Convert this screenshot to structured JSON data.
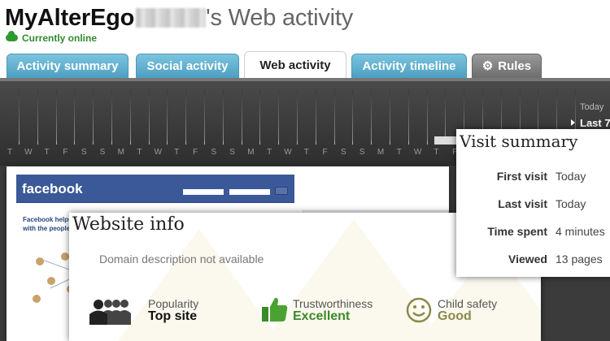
{
  "header": {
    "username": "MyAlterEgo",
    "title_suffix": "'s Web activity",
    "status": "Currently online"
  },
  "tabs": [
    {
      "label": "Activity summary",
      "icon": null
    },
    {
      "label": "Social activity",
      "icon": null
    },
    {
      "label": "Web activity",
      "icon": null,
      "active": true
    },
    {
      "label": "Activity timeline",
      "icon": null
    },
    {
      "label": "Rules",
      "icon": "gear-icon"
    }
  ],
  "timeline": {
    "days": [
      "T",
      "W",
      "T",
      "F",
      "S",
      "S",
      "M",
      "T",
      "W",
      "T",
      "F",
      "S",
      "S",
      "M",
      "T",
      "W",
      "T",
      "F",
      "S",
      "S",
      "M",
      "T",
      "W",
      "T",
      "F",
      "S",
      "S",
      "M",
      "T",
      "W",
      "T"
    ],
    "highlighted_days": [
      29,
      30
    ],
    "today_label": "Today",
    "range_label": "Last 7"
  },
  "website_preview": {
    "logo": "facebook",
    "tagline_1": "Facebook helps y",
    "tagline_2": "with the people i"
  },
  "website_info": {
    "title": "Website info",
    "description": "Domain description not available",
    "popularity": {
      "label": "Popularity",
      "value": "Top site",
      "icon": "people-icon"
    },
    "trustworthiness": {
      "label": "Trustworthiness",
      "value": "Excellent",
      "icon": "thumbs-up-icon"
    },
    "child_safety": {
      "label": "Child safety",
      "value": "Good",
      "icon": "smiley-icon"
    }
  },
  "visit_summary": {
    "title": "Visit summary",
    "rows": [
      {
        "key": "First visit",
        "value": "Today"
      },
      {
        "key": "Last visit",
        "value": "Today"
      },
      {
        "key": "Time spent",
        "value": "4 minutes"
      },
      {
        "key": "Viewed",
        "value": "13 pages"
      }
    ]
  },
  "colors": {
    "tab_blue": "#5aaed0",
    "tab_gray": "#7a7a7a",
    "online_green": "#2e8b2e",
    "trust_green": "#3a8a2a",
    "safety_olive": "#8a8a4a"
  }
}
